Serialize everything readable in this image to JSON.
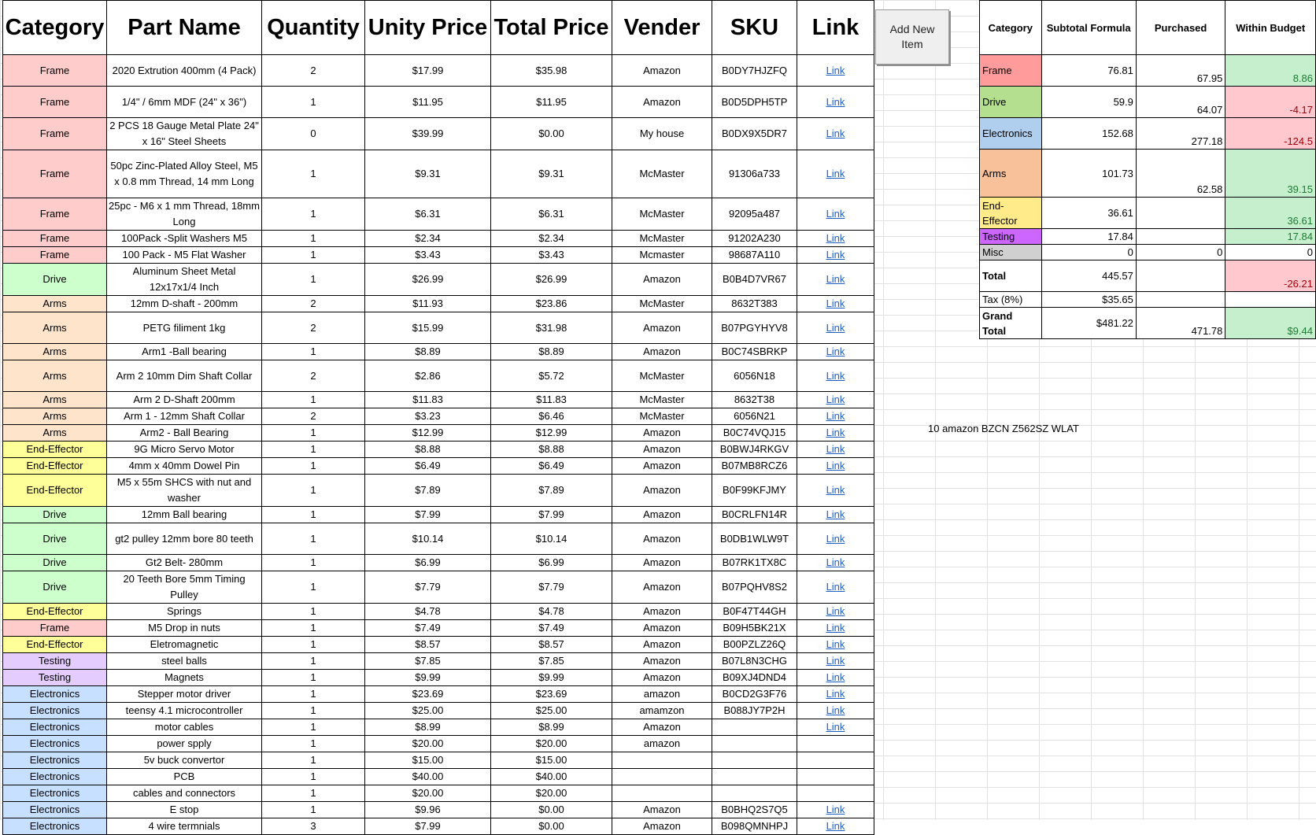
{
  "main": {
    "headers": {
      "category": "Category",
      "part_name": "Part Name",
      "quantity": "Quantity",
      "unit_price": "Unity Price",
      "total_price": "Total Price",
      "vendor": "Vender",
      "sku": "SKU",
      "link": "Link"
    },
    "rows": [
      {
        "category": "Frame",
        "cls": "frame",
        "name": "2020 Extrution 400mm (4 Pack)",
        "qty": "2",
        "unit": "$17.99",
        "total": "$35.98",
        "vendor": "Amazon",
        "sku": "B0DY7HJZFQ",
        "link": "Link"
      },
      {
        "category": "Frame",
        "cls": "frame",
        "name": "1/4\" / 6mm MDF (24\" x 36\")",
        "qty": "1",
        "unit": "$11.95",
        "total": "$11.95",
        "vendor": "Amazon",
        "sku": "B0D5DPH5TP",
        "link": "Link"
      },
      {
        "category": "Frame",
        "cls": "frame",
        "name": "2 PCS 18 Gauge Metal Plate 24\" x 16\" Steel Sheets",
        "qty": "0",
        "unit": "$39.99",
        "total": "$0.00",
        "vendor": "My house",
        "sku": "B0DX9X5DR7",
        "link": "Link"
      },
      {
        "category": "Frame",
        "cls": "frame",
        "name": "50pc Zinc-Plated Alloy Steel, M5 x 0.8 mm Thread, 14 mm Long",
        "qty": "1",
        "unit": "$9.31",
        "total": "$9.31",
        "vendor": "McMaster",
        "sku": "91306a733",
        "link": "Link"
      },
      {
        "category": "Frame",
        "cls": "frame",
        "name": "25pc - M6 x 1 mm Thread, 18mm Long",
        "qty": "1",
        "unit": "$6.31",
        "total": "$6.31",
        "vendor": "McMaster",
        "sku": "92095a487",
        "link": "Link"
      },
      {
        "category": "Frame",
        "cls": "frame",
        "name": "100Pack -Split Washers M5",
        "qty": "1",
        "unit": "$2.34",
        "total": "$2.34",
        "vendor": "McMaster",
        "sku": "91202A230",
        "link": "Link"
      },
      {
        "category": "Frame",
        "cls": "frame",
        "name": "100 Pack - M5 Flat Washer",
        "qty": "1",
        "unit": "$3.43",
        "total": "$3.43",
        "vendor": "Mcmaster",
        "sku": "98687A110",
        "link": "Link"
      },
      {
        "category": "Drive",
        "cls": "drive",
        "name": "Aluminum Sheet Metal 12x17x1/4 Inch",
        "qty": "1",
        "unit": "$26.99",
        "total": "$26.99",
        "vendor": "Amazon",
        "sku": "B0B4D7VR67",
        "link": "Link"
      },
      {
        "category": "Arms",
        "cls": "arms",
        "name": "12mm D-shaft - 200mm",
        "qty": "2",
        "unit": "$11.93",
        "total": "$23.86",
        "vendor": "McMaster",
        "sku": "8632T383",
        "link": "Link"
      },
      {
        "category": "Arms",
        "cls": "arms",
        "name": "PETG filiment 1kg",
        "qty": "2",
        "unit": "$15.99",
        "total": "$31.98",
        "vendor": "Amazon",
        "sku": "B07PGYHYV8",
        "link": "Link"
      },
      {
        "category": "Arms",
        "cls": "arms",
        "name": "Arm1 -Ball bearing",
        "qty": "1",
        "unit": "$8.89",
        "total": "$8.89",
        "vendor": "Amazon",
        "sku": "B0C74SBRKP",
        "link": "Link",
        "big": true
      },
      {
        "category": "Arms",
        "cls": "arms",
        "name": "Arm 2 10mm Dim Shaft Collar",
        "qty": "2",
        "unit": "$2.86",
        "total": "$5.72",
        "vendor": "McMaster",
        "sku": "6056N18",
        "link": "Link"
      },
      {
        "category": "Arms",
        "cls": "arms",
        "name": "Arm 2 D-Shaft 200mm",
        "qty": "1",
        "unit": "$11.83",
        "total": "$11.83",
        "vendor": "McMaster",
        "sku": "8632T38",
        "link": "Link"
      },
      {
        "category": "Arms",
        "cls": "arms",
        "name": "Arm 1 - 12mm Shaft Collar",
        "qty": "2",
        "unit": "$3.23",
        "total": "$6.46",
        "vendor": "McMaster",
        "sku": "6056N21",
        "link": "Link"
      },
      {
        "category": "Arms",
        "cls": "arms",
        "name": "Arm2 - Ball Bearing",
        "qty": "1",
        "unit": "$12.99",
        "total": "$12.99",
        "vendor": "Amazon",
        "sku": "B0C74VQJ15",
        "link": "Link",
        "big": true
      },
      {
        "category": "End-Effector",
        "cls": "ee",
        "name": "9G Micro Servo Motor",
        "qty": "1",
        "unit": "$8.88",
        "total": "$8.88",
        "vendor": "Amazon",
        "sku": "B0BWJ4RKGV",
        "link": "Link"
      },
      {
        "category": "End-Effector",
        "cls": "ee",
        "name": "4mm x 40mm Dowel Pin",
        "qty": "1",
        "unit": "$6.49",
        "total": "$6.49",
        "vendor": "Amazon",
        "sku": "B07MB8RCZ6",
        "link": "Link"
      },
      {
        "category": "End-Effector",
        "cls": "ee",
        "name": "M5 x 55m SHCS with nut and washer",
        "qty": "1",
        "unit": "$7.89",
        "total": "$7.89",
        "vendor": "Amazon",
        "sku": "B0F99KFJMY",
        "link": "Link"
      },
      {
        "category": "Drive",
        "cls": "drive",
        "name": "12mm Ball bearing",
        "qty": "1",
        "unit": "$7.99",
        "total": "$7.99",
        "vendor": "Amazon",
        "sku": "B0CRLFN14R",
        "link": "Link",
        "big": true
      },
      {
        "category": "Drive",
        "cls": "drive",
        "name": "gt2 pulley 12mm bore 80 teeth",
        "qty": "1",
        "unit": "$10.14",
        "total": "$10.14",
        "vendor": "Amazon",
        "sku": "B0DB1WLW9T",
        "link": "Link"
      },
      {
        "category": "Drive",
        "cls": "drive",
        "name": "Gt2 Belt- 280mm",
        "qty": "1",
        "unit": "$6.99",
        "total": "$6.99",
        "vendor": "Amazon",
        "sku": "B07RK1TX8C",
        "link": "Link"
      },
      {
        "category": "Drive",
        "cls": "drive",
        "name": "20 Teeth Bore 5mm Timing Pulley",
        "qty": "1",
        "unit": "$7.79",
        "total": "$7.79",
        "vendor": "Amazon",
        "sku": "B07PQHV8S2",
        "link": "Link"
      },
      {
        "category": "End-Effector",
        "cls": "ee",
        "name": "Springs",
        "qty": "1",
        "unit": "$4.78",
        "total": "$4.78",
        "vendor": "Amazon",
        "sku": "B0F47T44GH",
        "link": "Link"
      },
      {
        "category": "Frame",
        "cls": "frame",
        "name": "M5 Drop in nuts",
        "qty": "1",
        "unit": "$7.49",
        "total": "$7.49",
        "vendor": "Amazon",
        "sku": "B09H5BK21X",
        "link": "Link"
      },
      {
        "category": "End-Effector",
        "cls": "ee",
        "name": "Eletromagnetic",
        "qty": "1",
        "unit": "$8.57",
        "total": "$8.57",
        "vendor": "Amazon",
        "sku": "B00PZLZ26Q",
        "link": "Link"
      },
      {
        "category": "Testing",
        "cls": "test",
        "name": "steel balls",
        "qty": "1",
        "unit": "$7.85",
        "total": "$7.85",
        "vendor": "Amazon",
        "sku": "B07L8N3CHG",
        "link": "Link"
      },
      {
        "category": "Testing",
        "cls": "test",
        "name": "Magnets",
        "qty": "1",
        "unit": "$9.99",
        "total": "$9.99",
        "vendor": "Amazon",
        "sku": "B09XJ4DND4",
        "link": "Link"
      },
      {
        "category": "Electronics",
        "cls": "elec",
        "name": "Stepper motor driver",
        "qty": "1",
        "unit": "$23.69",
        "total": "$23.69",
        "vendor": "amazon",
        "sku": "B0CD2G3F76",
        "link": "Link"
      },
      {
        "category": "Electronics",
        "cls": "elec",
        "name": "teensy 4.1 microcontroller",
        "qty": "1",
        "unit": "$25.00",
        "total": "$25.00",
        "vendor": "amamzon",
        "sku": "B088JY7P2H",
        "link": "Link"
      },
      {
        "category": "Electronics",
        "cls": "elec",
        "name": "motor cables",
        "qty": "1",
        "unit": "$8.99",
        "total": "$8.99",
        "vendor": "Amazon",
        "sku": "",
        "link": "Link"
      },
      {
        "category": "Electronics",
        "cls": "elec",
        "name": "power spply",
        "qty": "1",
        "unit": "$20.00",
        "total": "$20.00",
        "vendor": "amazon",
        "sku": "",
        "link": ""
      },
      {
        "category": "Electronics",
        "cls": "elec",
        "name": "5v buck convertor",
        "qty": "1",
        "unit": "$15.00",
        "total": "$15.00",
        "vendor": "",
        "sku": "",
        "link": ""
      },
      {
        "category": "Electronics",
        "cls": "elec",
        "name": "PCB",
        "qty": "1",
        "unit": "$40.00",
        "total": "$40.00",
        "vendor": "",
        "sku": "",
        "link": ""
      },
      {
        "category": "Electronics",
        "cls": "elec",
        "name": "cables and connectors",
        "qty": "1",
        "unit": "$20.00",
        "total": "$20.00",
        "vendor": "",
        "sku": "",
        "link": ""
      },
      {
        "category": "Electronics",
        "cls": "elec",
        "name": "E stop",
        "qty": "1",
        "unit": "$9.96",
        "total": "$0.00",
        "vendor": "Amazon",
        "sku": "B0BHQ2S7Q5",
        "link": "Link"
      },
      {
        "category": "Electronics",
        "cls": "elec",
        "name": "4 wire termnials",
        "qty": "3",
        "unit": "$7.99",
        "total": "$0.00",
        "vendor": "Amazon",
        "sku": "B098QMNHPJ",
        "link": "Link"
      }
    ]
  },
  "add_button": {
    "label": "Add New Item"
  },
  "summary": {
    "headers": {
      "category": "Category",
      "subtotal": "Subtotal Formula",
      "purchased": "Purchased",
      "within_budget": "Within Budget"
    },
    "rows": [
      {
        "category": "Frame",
        "cls": "frame",
        "subtotal": "76.81",
        "purchased": "67.95",
        "budget": "8.86",
        "status": "pos"
      },
      {
        "category": "Drive",
        "cls": "drive",
        "subtotal": "59.9",
        "purchased": "64.07",
        "budget": "-4.17",
        "status": "neg"
      },
      {
        "category": "Electronics",
        "cls": "elec",
        "subtotal": "152.68",
        "purchased": "277.18",
        "budget": "-124.5",
        "status": "neg"
      },
      {
        "category": "Arms",
        "cls": "arms",
        "subtotal": "101.73",
        "purchased": "62.58",
        "budget": "39.15",
        "status": "pos"
      },
      {
        "category": "End-Effector",
        "cls": "ee",
        "subtotal": "36.61",
        "purchased": "",
        "budget": "36.61",
        "status": "pos"
      },
      {
        "category": "Testing",
        "cls": "test",
        "subtotal": "17.84",
        "purchased": "",
        "budget": "17.84",
        "status": "pos"
      },
      {
        "category": "Misc",
        "cls": "misc",
        "subtotal": "0",
        "purchased": "0",
        "budget": "0",
        "status": "plain"
      }
    ],
    "total": {
      "label": "Total",
      "subtotal": "445.57",
      "purchased": "",
      "budget": "-26.21",
      "status": "neg"
    },
    "tax": {
      "label": "Tax (8%)",
      "subtotal": "$35.65"
    },
    "grand_total": {
      "label": "Grand Total",
      "subtotal": "$481.22",
      "purchased": "471.78",
      "budget": "$9.44",
      "status": "pos"
    }
  },
  "note": {
    "text": "10 amazon BZCN Z562SZ WLAT"
  }
}
